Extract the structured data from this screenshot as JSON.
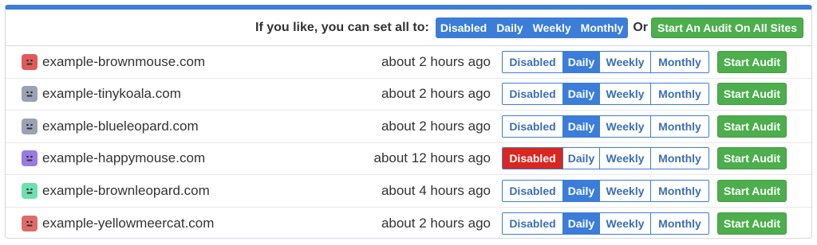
{
  "header": {
    "label": "If you like, you can set all to:",
    "bulk_options": [
      "Disabled",
      "Daily",
      "Weekly",
      "Monthly"
    ],
    "or_label": "Or",
    "audit_all_label": "Start An Audit On All Sites"
  },
  "frequency_options": [
    "Disabled",
    "Daily",
    "Weekly",
    "Monthly"
  ],
  "start_audit_label": "Start Audit",
  "sites": [
    {
      "name": "example-brownmouse.com",
      "last_audit": "about 2 hours ago",
      "selected": "Daily",
      "icon_color": "#e05a5a"
    },
    {
      "name": "example-tinykoala.com",
      "last_audit": "about 2 hours ago",
      "selected": "Daily",
      "icon_color": "#9aa3b5"
    },
    {
      "name": "example-blueleopard.com",
      "last_audit": "about 2 hours ago",
      "selected": "Daily",
      "icon_color": "#9aa3b5"
    },
    {
      "name": "example-happymouse.com",
      "last_audit": "about 12 hours ago",
      "selected": "Disabled",
      "icon_color": "#9a7be0"
    },
    {
      "name": "example-brownleopard.com",
      "last_audit": "about 4 hours ago",
      "selected": "Daily",
      "icon_color": "#6ee0b0"
    },
    {
      "name": "example-yellowmeercat.com",
      "last_audit": "about 2 hours ago",
      "selected": "Daily",
      "icon_color": "#e06a6a"
    }
  ],
  "colors": {
    "accent": "#3b7dd8",
    "success": "#4cae4c",
    "danger": "#d9271f"
  }
}
